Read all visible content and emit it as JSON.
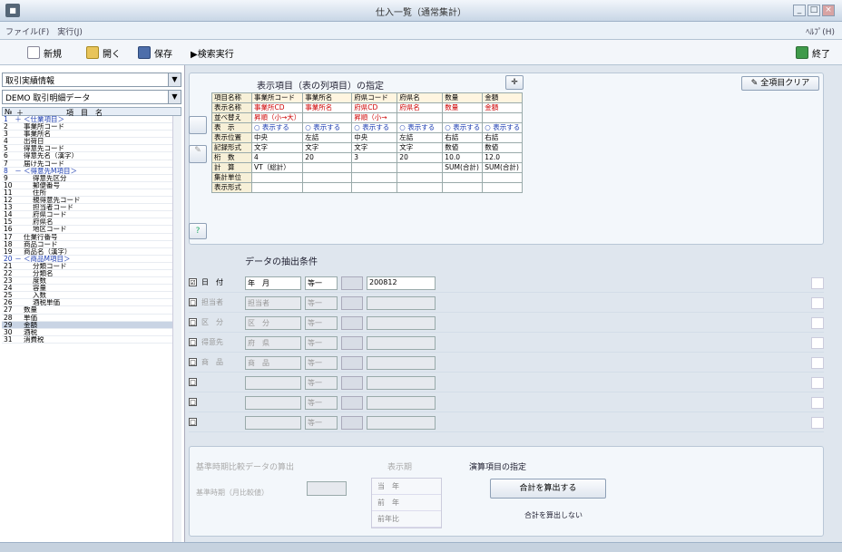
{
  "window": {
    "title": "仕入一覧（通常集計）"
  },
  "menu": {
    "left": "ファイル(F)　実行(J)",
    "right": "ﾍﾙﾌﾟ(H)"
  },
  "toolbar": {
    "new": "新規",
    "open": "開く",
    "save": "保存",
    "run": "▶検索実行",
    "exit": "終了"
  },
  "left": {
    "combo1": "取引実績情報",
    "combo2": "DEMO 取引明細データ",
    "header": {
      "no": "№",
      "mark": "＋",
      "item": "項　目　名"
    },
    "items": [
      {
        "no": "1",
        "mark": "＋",
        "label": "＜仕業項目＞",
        "grp": true
      },
      {
        "no": "2",
        "mark": "",
        "label": "事業所コード"
      },
      {
        "no": "3",
        "mark": "",
        "label": "事業所名"
      },
      {
        "no": "4",
        "mark": "",
        "label": "出荷日"
      },
      {
        "no": "5",
        "mark": "",
        "label": "得意先コード"
      },
      {
        "no": "6",
        "mark": "",
        "label": "得意先名（漢字）"
      },
      {
        "no": "7",
        "mark": "",
        "label": "届け先コード"
      },
      {
        "no": "8",
        "mark": "－",
        "label": "＜得意先M項目＞",
        "grp": true
      },
      {
        "no": "9",
        "mark": "",
        "label": "得意先区分",
        "ind": true
      },
      {
        "no": "10",
        "mark": "",
        "label": "郵便番号",
        "ind": true
      },
      {
        "no": "11",
        "mark": "",
        "label": "住所",
        "ind": true
      },
      {
        "no": "12",
        "mark": "",
        "label": "親得意先コード",
        "ind": true
      },
      {
        "no": "13",
        "mark": "",
        "label": "担当者コード",
        "ind": true
      },
      {
        "no": "14",
        "mark": "",
        "label": "府県コード",
        "ind": true
      },
      {
        "no": "15",
        "mark": "",
        "label": "府県名",
        "ind": true
      },
      {
        "no": "16",
        "mark": "",
        "label": "地区コード",
        "ind": true
      },
      {
        "no": "17",
        "mark": "",
        "label": "仕業行番号"
      },
      {
        "no": "18",
        "mark": "",
        "label": "商品コード"
      },
      {
        "no": "19",
        "mark": "",
        "label": "商品名（漢字）"
      },
      {
        "no": "20",
        "mark": "－",
        "label": "＜商品M項目＞",
        "grp": true
      },
      {
        "no": "21",
        "mark": "",
        "label": "分類コード",
        "ind": true
      },
      {
        "no": "22",
        "mark": "",
        "label": "分類名",
        "ind": true
      },
      {
        "no": "23",
        "mark": "",
        "label": "度数",
        "ind": true
      },
      {
        "no": "24",
        "mark": "",
        "label": "容量",
        "ind": true
      },
      {
        "no": "25",
        "mark": "",
        "label": "入数",
        "ind": true
      },
      {
        "no": "26",
        "mark": "",
        "label": "酒税単価",
        "ind": true
      },
      {
        "no": "27",
        "mark": "",
        "label": "数量"
      },
      {
        "no": "28",
        "mark": "",
        "label": "単価"
      },
      {
        "no": "29",
        "mark": "",
        "label": "金額",
        "sel": true
      },
      {
        "no": "30",
        "mark": "",
        "label": "酒税"
      },
      {
        "no": "31",
        "mark": "",
        "label": "消費税"
      }
    ]
  },
  "display": {
    "title": "表示項目（表の列項目）の指定",
    "clear_all": "全項目クリア",
    "help": "?",
    "columns": [
      {
        "c": "事業所コード",
        "v": [
          "事業所CD",
          "昇順（小→大）",
          "○ 表示する",
          "中央",
          "文字",
          "4",
          "",
          "",
          "",
          ""
        ]
      },
      {
        "c": "事業所名",
        "v": [
          "事業所名",
          "",
          "○ 表示する",
          "左詰",
          "文字",
          "20",
          "",
          "",
          "",
          ""
        ]
      },
      {
        "c": "府県コード",
        "v": [
          "府県CD",
          "昇順（小→",
          "○ 表示する",
          "中央",
          "文字",
          "3",
          "",
          "",
          "",
          ""
        ]
      },
      {
        "c": "府県名",
        "v": [
          "府県名",
          "",
          "○ 表示する",
          "左詰",
          "文字",
          "20",
          "",
          "",
          "",
          ""
        ]
      },
      {
        "c": "数量",
        "v": [
          "数量",
          "",
          "○ 表示する",
          "右詰",
          "数値",
          "10.0",
          "SUM(合計)",
          "",
          "",
          "1234567890"
        ]
      },
      {
        "c": "金額",
        "v": [
          "金額",
          "",
          "○ 表示する",
          "右詰",
          "数値",
          "12.0",
          "SUM(合計)",
          "",
          "",
          "1234567890"
        ]
      }
    ],
    "row_labels": [
      "項目名称",
      "表示名称",
      "並べ替え",
      "表　示",
      "表示位置",
      "記録形式",
      "桁　数",
      "計　算",
      "集計単位",
      "表示形式"
    ],
    "calc_first": "VT（総計）"
  },
  "extract": {
    "title": "データの抽出条件",
    "rows": [
      {
        "checked": "☑",
        "label": "日　付",
        "f1": "年　月",
        "f2": "等一",
        "value": "200812",
        "enabled": true
      },
      {
        "checked": "□",
        "label": "担当者",
        "f1": "担当者",
        "f2": "等一",
        "value": "",
        "enabled": false
      },
      {
        "checked": "□",
        "label": "区　分",
        "f1": "区　分",
        "f2": "等一",
        "value": "",
        "enabled": false
      },
      {
        "checked": "□",
        "label": "得意先",
        "f1": "府　県",
        "f2": "等一",
        "value": "",
        "enabled": false
      },
      {
        "checked": "□",
        "label": "商　品",
        "f1": "商　品",
        "f2": "等一",
        "value": "",
        "enabled": false
      },
      {
        "checked": "□",
        "label": "",
        "f1": "",
        "f2": "等一",
        "value": "",
        "enabled": false
      },
      {
        "checked": "□",
        "label": "",
        "f1": "",
        "f2": "等一",
        "value": "",
        "enabled": false
      },
      {
        "checked": "□",
        "label": "",
        "f1": "",
        "f2": "等一",
        "value": "",
        "enabled": false
      }
    ]
  },
  "bottom": {
    "compare_title": "基準時期比較データの算出",
    "compare_label": "基準時期（月比較値）",
    "period_title": "表示期",
    "periods": [
      "当　年",
      "前　年",
      "前年比"
    ],
    "calc_title": "演算項目の指定",
    "calc_button": "合計を算出する",
    "calc_option": "合計を算出しない"
  }
}
